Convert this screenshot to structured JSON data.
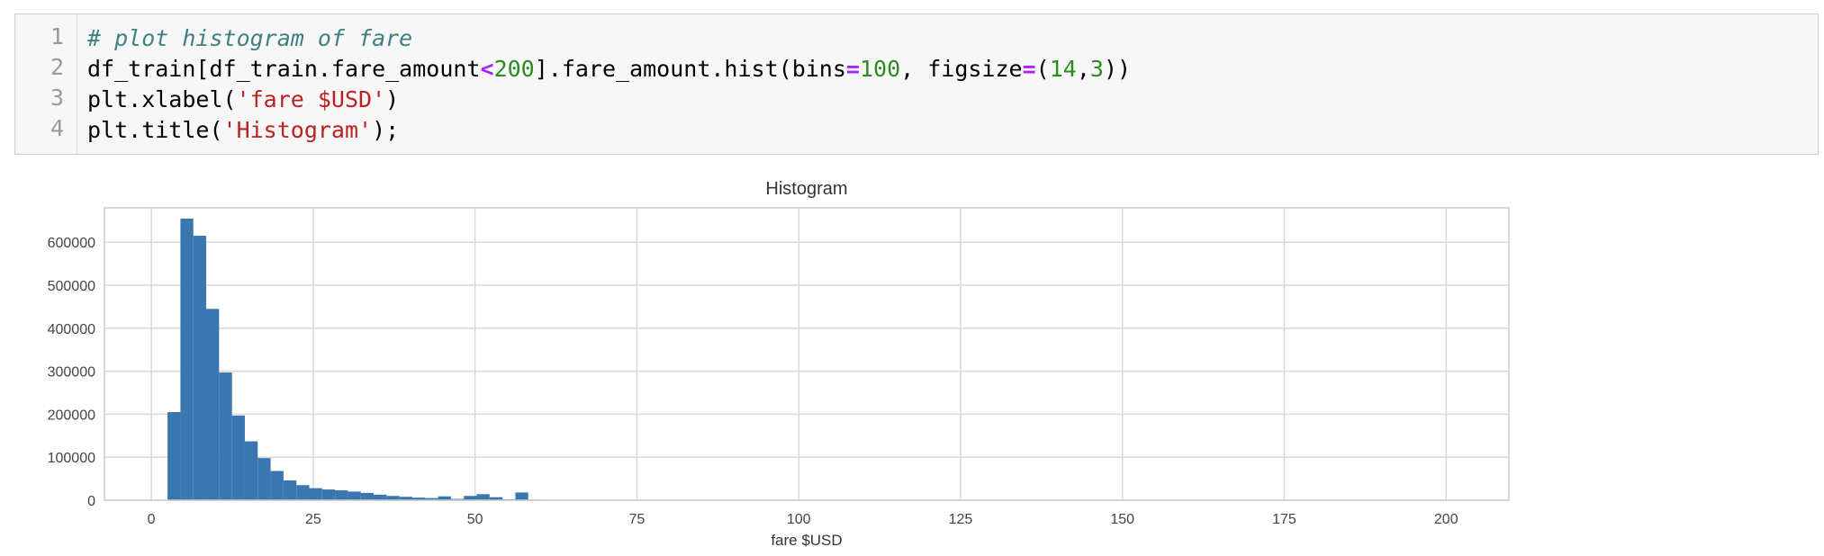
{
  "code_cell": {
    "line_numbers": [
      "1",
      "2",
      "3",
      "4"
    ],
    "lines": [
      [
        {
          "t": "comment",
          "v": "# plot histogram of fare"
        }
      ],
      [
        {
          "t": "plain",
          "v": "df_train[df_train.fare_amount"
        },
        {
          "t": "op",
          "v": "<"
        },
        {
          "t": "num",
          "v": "200"
        },
        {
          "t": "plain",
          "v": "].fare_amount.hist(bins"
        },
        {
          "t": "op",
          "v": "="
        },
        {
          "t": "num",
          "v": "100"
        },
        {
          "t": "plain",
          "v": ", figsize"
        },
        {
          "t": "op",
          "v": "="
        },
        {
          "t": "plain",
          "v": "("
        },
        {
          "t": "num",
          "v": "14"
        },
        {
          "t": "plain",
          "v": ","
        },
        {
          "t": "num",
          "v": "3"
        },
        {
          "t": "plain",
          "v": "))"
        }
      ],
      [
        {
          "t": "plain",
          "v": "plt.xlabel("
        },
        {
          "t": "str",
          "v": "'fare $USD'"
        },
        {
          "t": "plain",
          "v": ")"
        }
      ],
      [
        {
          "t": "plain",
          "v": "plt.title("
        },
        {
          "t": "str",
          "v": "'Histogram'"
        },
        {
          "t": "plain",
          "v": ");"
        }
      ]
    ]
  },
  "chart_data": {
    "type": "bar",
    "title": "Histogram",
    "xlabel": "fare $USD",
    "ylabel": "",
    "xlim": [
      -7.25,
      209.7
    ],
    "ylim": [
      0,
      680000
    ],
    "xticks": [
      0,
      25,
      50,
      75,
      100,
      125,
      150,
      175,
      200
    ],
    "yticks": [
      0,
      100000,
      200000,
      300000,
      400000,
      500000,
      600000
    ],
    "grid": true,
    "bin_width": 1.99,
    "bins": [
      {
        "x": 2.5,
        "y": 205000
      },
      {
        "x": 4.49,
        "y": 655000
      },
      {
        "x": 6.48,
        "y": 615000
      },
      {
        "x": 8.47,
        "y": 445000
      },
      {
        "x": 10.46,
        "y": 297000
      },
      {
        "x": 12.45,
        "y": 197000
      },
      {
        "x": 14.44,
        "y": 137000
      },
      {
        "x": 16.43,
        "y": 98000
      },
      {
        "x": 18.42,
        "y": 68000
      },
      {
        "x": 20.41,
        "y": 46000
      },
      {
        "x": 22.4,
        "y": 35000
      },
      {
        "x": 24.39,
        "y": 28000
      },
      {
        "x": 26.38,
        "y": 25000
      },
      {
        "x": 28.37,
        "y": 23000
      },
      {
        "x": 30.36,
        "y": 20000
      },
      {
        "x": 32.35,
        "y": 17000
      },
      {
        "x": 34.34,
        "y": 13000
      },
      {
        "x": 36.33,
        "y": 10000
      },
      {
        "x": 38.32,
        "y": 8000
      },
      {
        "x": 40.31,
        "y": 6000
      },
      {
        "x": 42.3,
        "y": 5000
      },
      {
        "x": 44.29,
        "y": 9000
      },
      {
        "x": 46.28,
        "y": 3000
      },
      {
        "x": 48.27,
        "y": 10000
      },
      {
        "x": 50.26,
        "y": 14000
      },
      {
        "x": 52.25,
        "y": 7000
      },
      {
        "x": 54.24,
        "y": 2000
      },
      {
        "x": 56.23,
        "y": 18000
      },
      {
        "x": 58.22,
        "y": 1500
      },
      {
        "x": 60.21,
        "y": 1000
      },
      {
        "x": 62.2,
        "y": 800
      },
      {
        "x": 64.19,
        "y": 600
      },
      {
        "x": 66.18,
        "y": 500
      }
    ],
    "colors": {
      "bar": "#3a76b0",
      "grid": "#d8d8d8",
      "frame": "#cccccc"
    }
  }
}
